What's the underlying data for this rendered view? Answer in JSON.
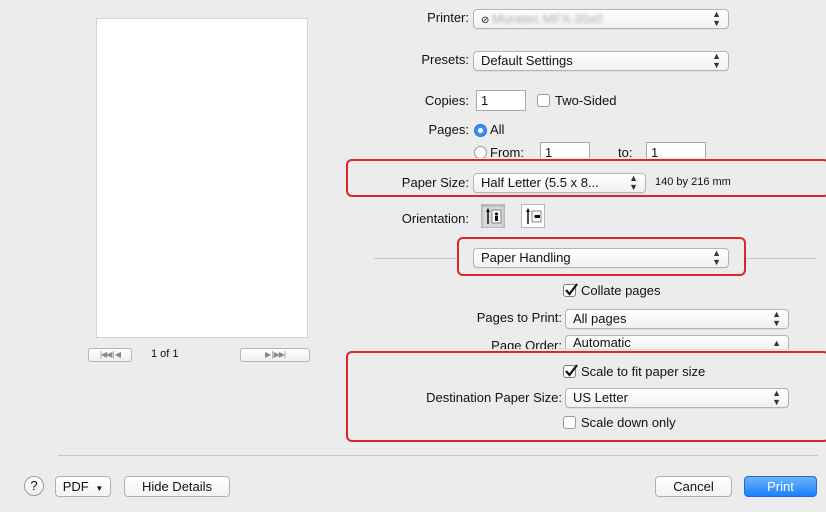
{
  "printer": {
    "label": "Printer:",
    "value": "Muratec MFX-35x0"
  },
  "presets": {
    "label": "Presets:",
    "value": "Default Settings"
  },
  "copies": {
    "label": "Copies:",
    "value": "1",
    "two_sided_label": "Two-Sided"
  },
  "pages": {
    "label": "Pages:",
    "all_label": "All",
    "from_label": "From:",
    "from_value": "1",
    "to_label": "to:",
    "to_value": "1"
  },
  "paper_size": {
    "label": "Paper Size:",
    "value": "Half Letter (5.5 x 8...",
    "dimensions": "140 by 216 mm"
  },
  "orientation": {
    "label": "Orientation:"
  },
  "section_popup": {
    "value": "Paper Handling"
  },
  "collate": {
    "label": "Collate pages",
    "checked": true
  },
  "pages_to_print": {
    "label": "Pages to Print:",
    "value": "All pages"
  },
  "page_order": {
    "label": "Page Order:",
    "value": "Automatic"
  },
  "scale_to_fit": {
    "label": "Scale to fit paper size",
    "checked": true
  },
  "destination_paper_size": {
    "label": "Destination Paper Size:",
    "value": "US Letter"
  },
  "scale_down_only": {
    "label": "Scale down only",
    "checked": false
  },
  "preview": {
    "page_indicator": "1 of 1"
  },
  "footer": {
    "help": "?",
    "pdf_label": "PDF",
    "hide_details_label": "Hide Details",
    "cancel_label": "Cancel",
    "print_label": "Print"
  },
  "colors": {
    "highlight_red": "#d9262a",
    "accent_blue": "#1a82fb"
  }
}
